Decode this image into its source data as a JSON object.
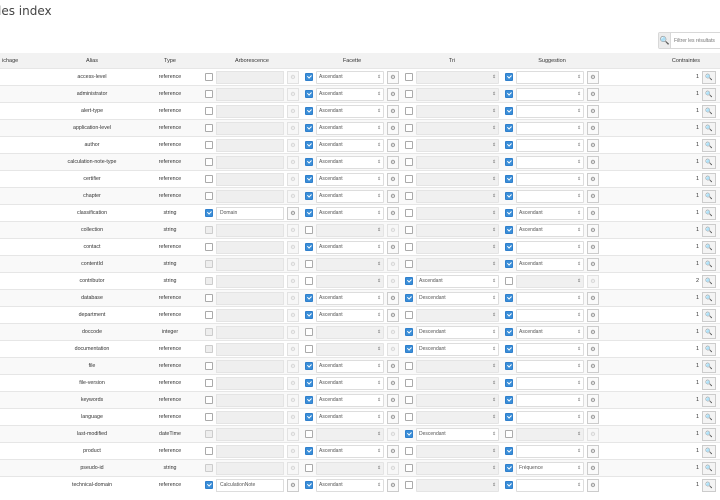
{
  "page": {
    "title": "les index"
  },
  "search": {
    "placeholder": "Filtrer les résultats"
  },
  "columns": [
    "ichage",
    "Alias",
    "Type",
    "Arborescence",
    "Facette",
    "Tri",
    "Suggestion",
    "Contraintes"
  ],
  "rows": [
    {
      "alias": "access-level",
      "type": "reference",
      "arb": {
        "on": false,
        "dis": false,
        "val": ""
      },
      "fac": {
        "on": true,
        "val": "Ascendant"
      },
      "tri": {
        "on": false,
        "val": ""
      },
      "sug": {
        "on": true,
        "val": ""
      },
      "count": "1"
    },
    {
      "alias": "administrator",
      "type": "reference",
      "arb": {
        "on": false,
        "dis": false,
        "val": ""
      },
      "fac": {
        "on": true,
        "val": "Ascendant"
      },
      "tri": {
        "on": false,
        "val": ""
      },
      "sug": {
        "on": true,
        "val": ""
      },
      "count": "1"
    },
    {
      "alias": "alert-type",
      "type": "reference",
      "arb": {
        "on": false,
        "dis": false,
        "val": ""
      },
      "fac": {
        "on": true,
        "val": "Ascendant"
      },
      "tri": {
        "on": false,
        "val": ""
      },
      "sug": {
        "on": true,
        "val": ""
      },
      "count": "1"
    },
    {
      "alias": "application-level",
      "type": "reference",
      "arb": {
        "on": false,
        "dis": false,
        "val": ""
      },
      "fac": {
        "on": true,
        "val": "Ascendant"
      },
      "tri": {
        "on": false,
        "val": ""
      },
      "sug": {
        "on": true,
        "val": ""
      },
      "count": "1"
    },
    {
      "alias": "author",
      "type": "reference",
      "arb": {
        "on": false,
        "dis": false,
        "val": ""
      },
      "fac": {
        "on": true,
        "val": "Ascendant"
      },
      "tri": {
        "on": false,
        "val": ""
      },
      "sug": {
        "on": true,
        "val": ""
      },
      "count": "1"
    },
    {
      "alias": "calculation-note-type",
      "type": "reference",
      "arb": {
        "on": false,
        "dis": false,
        "val": ""
      },
      "fac": {
        "on": true,
        "val": "Ascendant"
      },
      "tri": {
        "on": false,
        "val": ""
      },
      "sug": {
        "on": true,
        "val": ""
      },
      "count": "1"
    },
    {
      "alias": "certifier",
      "type": "reference",
      "arb": {
        "on": false,
        "dis": false,
        "val": ""
      },
      "fac": {
        "on": true,
        "val": "Ascendant"
      },
      "tri": {
        "on": false,
        "val": ""
      },
      "sug": {
        "on": true,
        "val": ""
      },
      "count": "1"
    },
    {
      "alias": "chapter",
      "type": "reference",
      "arb": {
        "on": false,
        "dis": false,
        "val": ""
      },
      "fac": {
        "on": true,
        "val": "Ascendant"
      },
      "tri": {
        "on": false,
        "val": ""
      },
      "sug": {
        "on": true,
        "val": ""
      },
      "count": "1"
    },
    {
      "alias": "classification",
      "type": "string",
      "arb": {
        "on": true,
        "dis": false,
        "val": "Domain"
      },
      "fac": {
        "on": true,
        "val": "Ascendant"
      },
      "tri": {
        "on": false,
        "val": ""
      },
      "sug": {
        "on": true,
        "val": "Ascendant"
      },
      "count": "1"
    },
    {
      "alias": "collection",
      "type": "string",
      "arb": {
        "on": false,
        "dis": true,
        "val": ""
      },
      "fac": {
        "on": false,
        "val": ""
      },
      "tri": {
        "on": false,
        "val": ""
      },
      "sug": {
        "on": true,
        "val": "Ascendant"
      },
      "count": "1"
    },
    {
      "alias": "contact",
      "type": "reference",
      "arb": {
        "on": false,
        "dis": false,
        "val": ""
      },
      "fac": {
        "on": true,
        "val": "Ascendant"
      },
      "tri": {
        "on": false,
        "val": ""
      },
      "sug": {
        "on": true,
        "val": ""
      },
      "count": "1"
    },
    {
      "alias": "contentId",
      "type": "string",
      "arb": {
        "on": false,
        "dis": true,
        "val": ""
      },
      "fac": {
        "on": false,
        "val": ""
      },
      "tri": {
        "on": false,
        "val": ""
      },
      "sug": {
        "on": true,
        "val": "Ascendant"
      },
      "count": "1"
    },
    {
      "alias": "contributor",
      "type": "string",
      "arb": {
        "on": false,
        "dis": true,
        "val": ""
      },
      "fac": {
        "on": false,
        "val": ""
      },
      "tri": {
        "on": true,
        "val": "Ascendant"
      },
      "sug": {
        "on": false,
        "val": ""
      },
      "count": "2"
    },
    {
      "alias": "database",
      "type": "reference",
      "arb": {
        "on": false,
        "dis": false,
        "val": ""
      },
      "fac": {
        "on": true,
        "val": "Ascendant"
      },
      "tri": {
        "on": true,
        "val": "Descendant"
      },
      "sug": {
        "on": true,
        "val": ""
      },
      "count": "1"
    },
    {
      "alias": "department",
      "type": "reference",
      "arb": {
        "on": false,
        "dis": false,
        "val": ""
      },
      "fac": {
        "on": true,
        "val": "Ascendant"
      },
      "tri": {
        "on": false,
        "val": ""
      },
      "sug": {
        "on": true,
        "val": ""
      },
      "count": "1"
    },
    {
      "alias": "doccode",
      "type": "integer",
      "arb": {
        "on": false,
        "dis": true,
        "val": ""
      },
      "fac": {
        "on": false,
        "val": ""
      },
      "tri": {
        "on": true,
        "val": "Descendant"
      },
      "sug": {
        "on": true,
        "val": "Ascendant"
      },
      "count": "1"
    },
    {
      "alias": "documentation",
      "type": "reference",
      "arb": {
        "on": false,
        "dis": true,
        "val": ""
      },
      "fac": {
        "on": false,
        "val": ""
      },
      "tri": {
        "on": true,
        "val": "Descendant"
      },
      "sug": {
        "on": true,
        "val": ""
      },
      "count": "1"
    },
    {
      "alias": "file",
      "type": "reference",
      "arb": {
        "on": false,
        "dis": false,
        "val": ""
      },
      "fac": {
        "on": true,
        "val": "Ascendant"
      },
      "tri": {
        "on": false,
        "val": ""
      },
      "sug": {
        "on": true,
        "val": ""
      },
      "count": "1"
    },
    {
      "alias": "file-version",
      "type": "reference",
      "arb": {
        "on": false,
        "dis": false,
        "val": ""
      },
      "fac": {
        "on": true,
        "val": "Ascendant"
      },
      "tri": {
        "on": false,
        "val": ""
      },
      "sug": {
        "on": true,
        "val": ""
      },
      "count": "1"
    },
    {
      "alias": "keywords",
      "type": "reference",
      "arb": {
        "on": false,
        "dis": false,
        "val": ""
      },
      "fac": {
        "on": true,
        "val": "Ascendant"
      },
      "tri": {
        "on": false,
        "val": ""
      },
      "sug": {
        "on": true,
        "val": ""
      },
      "count": "1"
    },
    {
      "alias": "language",
      "type": "reference",
      "arb": {
        "on": false,
        "dis": false,
        "val": ""
      },
      "fac": {
        "on": true,
        "val": "Ascendant"
      },
      "tri": {
        "on": false,
        "val": ""
      },
      "sug": {
        "on": true,
        "val": ""
      },
      "count": "1"
    },
    {
      "alias": "last-modified",
      "type": "dateTime",
      "arb": {
        "on": false,
        "dis": true,
        "val": ""
      },
      "fac": {
        "on": false,
        "val": ""
      },
      "tri": {
        "on": true,
        "val": "Descendant"
      },
      "sug": {
        "on": false,
        "val": ""
      },
      "count": "1"
    },
    {
      "alias": "product",
      "type": "reference",
      "arb": {
        "on": false,
        "dis": false,
        "val": ""
      },
      "fac": {
        "on": true,
        "val": "Ascendant"
      },
      "tri": {
        "on": false,
        "val": ""
      },
      "sug": {
        "on": true,
        "val": ""
      },
      "count": "1"
    },
    {
      "alias": "pseudo-id",
      "type": "string",
      "arb": {
        "on": false,
        "dis": true,
        "val": ""
      },
      "fac": {
        "on": false,
        "val": ""
      },
      "tri": {
        "on": false,
        "val": ""
      },
      "sug": {
        "on": true,
        "val": "Fréquence"
      },
      "count": "1"
    },
    {
      "alias": "technical-domain",
      "type": "reference",
      "arb": {
        "on": true,
        "dis": false,
        "val": "CalculationNote"
      },
      "fac": {
        "on": true,
        "val": "Ascendant"
      },
      "tri": {
        "on": false,
        "val": ""
      },
      "sug": {
        "on": true,
        "val": ""
      },
      "count": "1"
    }
  ]
}
